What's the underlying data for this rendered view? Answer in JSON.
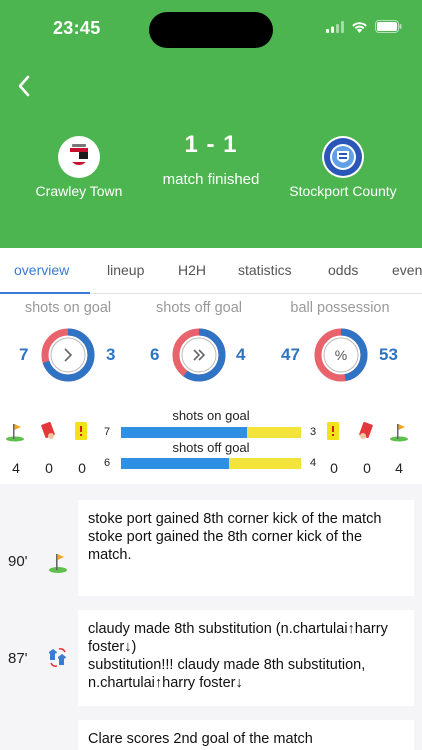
{
  "status_bar": {
    "time": "23:45"
  },
  "match": {
    "home": {
      "name": "Crawley Town",
      "goals_on": 7,
      "goals_off": 6
    },
    "away": {
      "name": "Stockport County"
    },
    "score": "1 - 1",
    "status": "match finished"
  },
  "tabs": [
    {
      "label": "overview",
      "active": true
    },
    {
      "label": "lineup"
    },
    {
      "label": "H2H"
    },
    {
      "label": "statistics"
    },
    {
      "label": "odds"
    },
    {
      "label": "even"
    }
  ],
  "stats": [
    {
      "title": "shots on goal",
      "home": "7",
      "away": "3",
      "icon": "chevron-right-icon",
      "label": ">",
      "home_fraction": 0.7
    },
    {
      "title": "shots off goal",
      "home": "6",
      "away": "4",
      "icon": "double-chevron-right-icon",
      "label": "»",
      "home_fraction": 0.6
    },
    {
      "title": "ball possession",
      "home": "47",
      "away": "53",
      "icon": "percent-icon",
      "label": "%",
      "home_fraction": 0.47
    }
  ],
  "events_summary": {
    "home": {
      "corners": "4",
      "red_cards": "0",
      "yellow_cards": "0"
    },
    "away": {
      "corners": "4",
      "red_cards": "0",
      "yellow_cards": "0"
    },
    "bars": [
      {
        "title": "shots on goal",
        "home": "7",
        "away": "3",
        "home_fraction": 0.7
      },
      {
        "title": "shots off goal",
        "home": "6",
        "away": "4",
        "home_fraction": 0.6
      }
    ]
  },
  "colors": {
    "header_green": "#4cb54f",
    "home_blue": "#2e73c4",
    "away_red": "#e8636b",
    "bar_yellow": "#f2e43a",
    "accent": "#3a7bd5"
  },
  "feed": [
    {
      "minute": "90'",
      "icon": "corner-flag-icon",
      "text": "stoke port gained 8th corner kick of the match\nstoke port gained the 8th corner kick of the match."
    },
    {
      "minute": "87'",
      "icon": "substitution-icon",
      "text": "claudy made 8th substitution (n.chartulai↑harry foster↓)\nsubstitution!!! claudy made 8th substitution, n.chartulai↑harry foster↓"
    },
    {
      "minute": "",
      "icon": "",
      "text": "Clare scores 2nd goal of the match"
    }
  ]
}
